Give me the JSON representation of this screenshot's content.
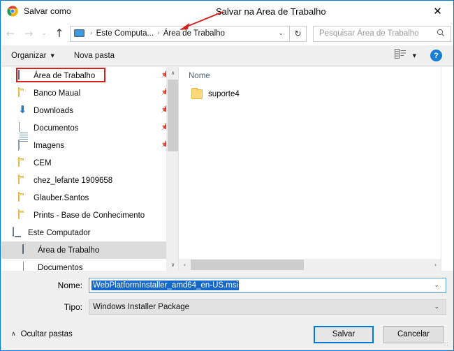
{
  "window": {
    "title": "Salvar como",
    "app_icon": "chrome-icon",
    "close_label": "✕"
  },
  "navbar": {
    "back": "←",
    "forward": "→",
    "history": "⌄",
    "up": "↑",
    "breadcrumb": {
      "root_icon": "this-pc-icon",
      "separator": "›",
      "items": [
        "Este Computa...",
        "Área de Trabalho"
      ],
      "caret": "⌄"
    },
    "refresh": "↻",
    "search": {
      "placeholder": "Pesquisar Área de Trabalho",
      "icon": "🔍"
    }
  },
  "toolbar": {
    "organize_label": "Organizar",
    "organize_caret": "▼",
    "new_folder_label": "Nova pasta",
    "view_caret": "▼",
    "help_label": "?"
  },
  "sidebar": {
    "quick_access": [
      {
        "label": "Área de Trabalho",
        "icon": "desktop-icon",
        "pinned": true,
        "selected": false,
        "highlighted": true
      },
      {
        "label": "Banco Maual",
        "icon": "folder-icon",
        "pinned": true,
        "selected": false,
        "highlighted": false
      },
      {
        "label": "Downloads",
        "icon": "downloads-icon",
        "pinned": true,
        "selected": false,
        "highlighted": false
      },
      {
        "label": "Documentos",
        "icon": "document-icon",
        "pinned": true,
        "selected": false,
        "highlighted": false
      },
      {
        "label": "Imagens",
        "icon": "pictures-icon",
        "pinned": true,
        "selected": false,
        "highlighted": false
      },
      {
        "label": "CEM",
        "icon": "folder-icon",
        "pinned": false,
        "selected": false,
        "highlighted": false
      },
      {
        "label": "chez_lefante 1909658",
        "icon": "folder-icon",
        "pinned": false,
        "selected": false,
        "highlighted": false
      },
      {
        "label": "Glauber.Santos",
        "icon": "folder-icon",
        "pinned": false,
        "selected": false,
        "highlighted": false
      },
      {
        "label": "Prints - Base de Conhecimento",
        "icon": "folder-icon",
        "pinned": false,
        "selected": false,
        "highlighted": false
      }
    ],
    "this_pc": {
      "label": "Este Computador",
      "icon": "this-pc-icon",
      "children": [
        {
          "label": "Área de Trabalho",
          "icon": "desktop-icon",
          "selected": true
        },
        {
          "label": "Documentos",
          "icon": "document-icon",
          "selected": false
        }
      ]
    },
    "scroll": {
      "up": "∧",
      "down": "∨"
    }
  },
  "file_list": {
    "columns": [
      "Nome"
    ],
    "rows": [
      {
        "name": "suporte4",
        "icon": "folder-icon"
      }
    ],
    "hscroll": {
      "left": "‹",
      "right": "›"
    }
  },
  "form": {
    "name_label": "Nome:",
    "name_value": "WebPlatformInstaller_amd64_en-US.msi",
    "name_caret": "⌄",
    "type_label": "Tipo:",
    "type_value": "Windows Installer Package",
    "type_caret": "⌄"
  },
  "footer": {
    "hide_folders_caret": "∧",
    "hide_folders_label": "Ocultar pastas",
    "save_label": "Salvar",
    "cancel_label": "Cancelar",
    "grip": "∷"
  },
  "annotations": {
    "note_text": "Salvar na Area de Trabalho",
    "accent_color": "#d42222"
  }
}
